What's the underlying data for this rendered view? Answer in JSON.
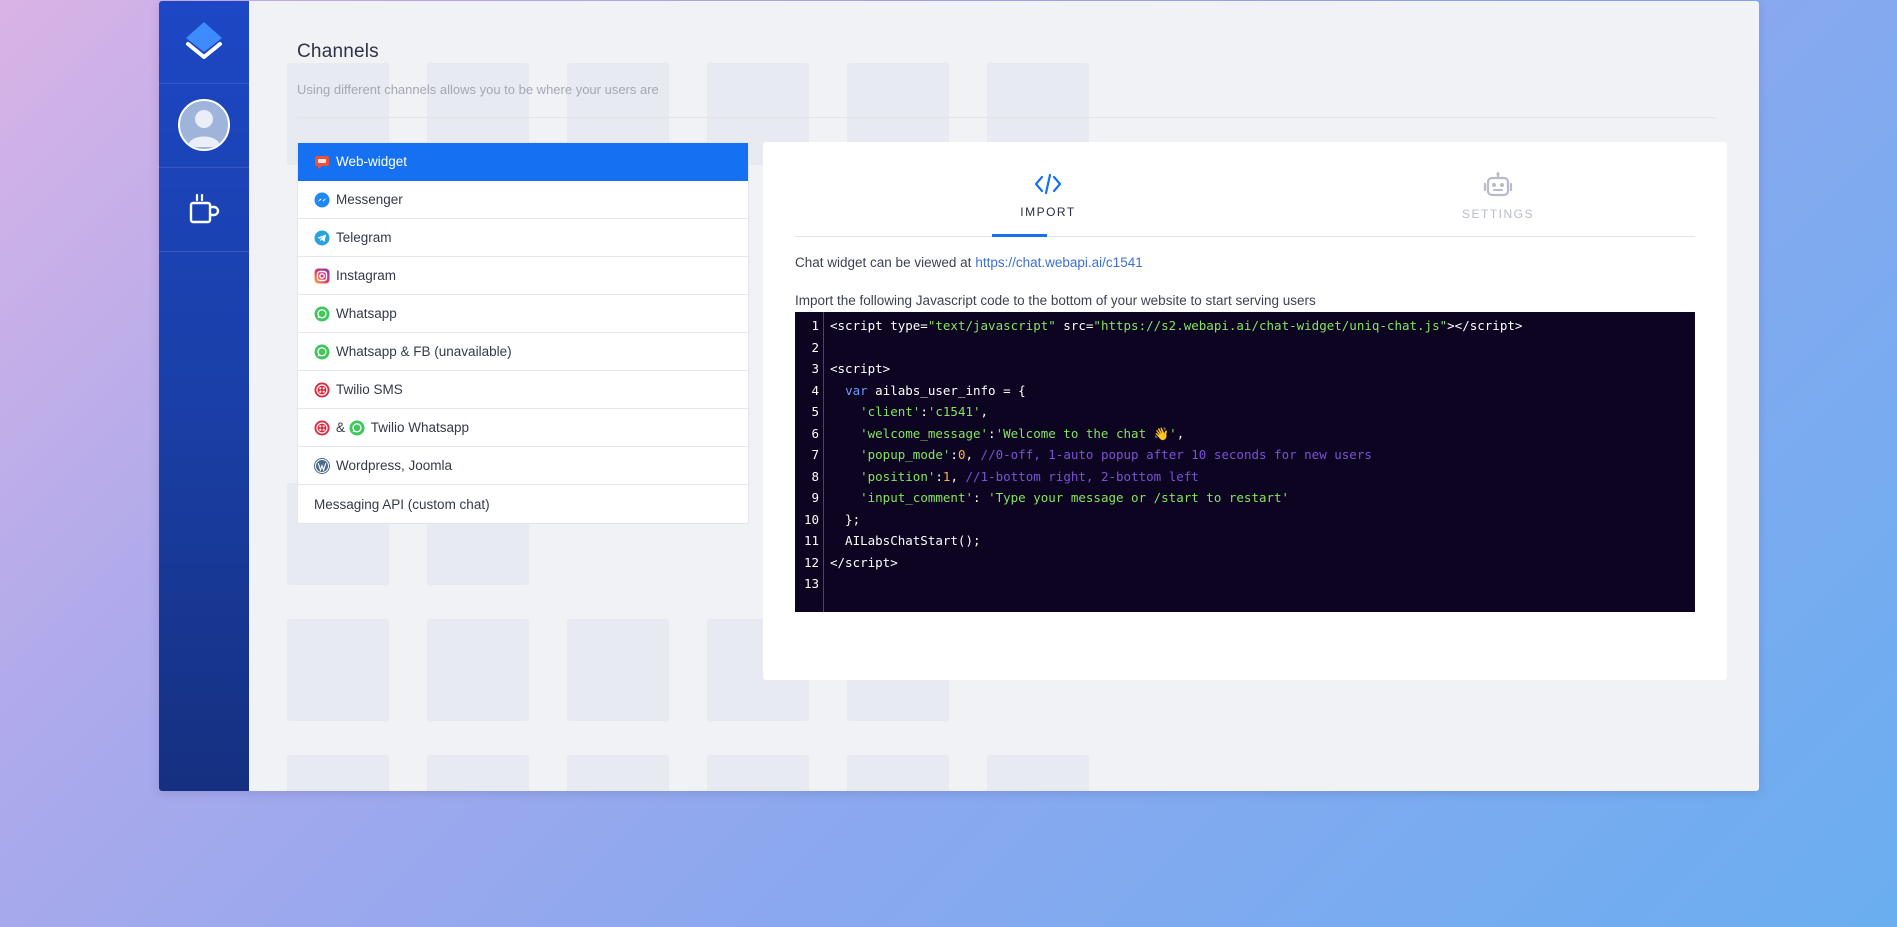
{
  "page": {
    "title": "Channels",
    "subtitle": "Using different channels allows you to be where your users are"
  },
  "sidebar": {
    "icons": [
      "logo-icon",
      "user-avatar-icon",
      "coffee-cup-icon"
    ]
  },
  "channels": [
    {
      "label": "Web-widget",
      "icon": "web-widget-icon",
      "active": true
    },
    {
      "label": "Messenger",
      "icon": "messenger-icon",
      "active": false
    },
    {
      "label": "Telegram",
      "icon": "telegram-icon",
      "active": false
    },
    {
      "label": "Instagram",
      "icon": "instagram-icon",
      "active": false
    },
    {
      "label": "Whatsapp",
      "icon": "whatsapp-icon",
      "active": false
    },
    {
      "label": "Whatsapp & FB (unavailable)",
      "icon": "whatsapp-icon",
      "active": false
    },
    {
      "label": "Twilio SMS",
      "icon": "twilio-icon",
      "active": false
    },
    {
      "label": "& ",
      "label2": "Twilio Whatsapp",
      "icon": "twilio-icon",
      "icon2": "whatsapp-icon",
      "active": false
    },
    {
      "label": "Wordpress, Joomla",
      "icon": "wordpress-icon",
      "active": false
    },
    {
      "label": "Messaging API (custom chat)",
      "icon": "",
      "active": false
    }
  ],
  "tabs": [
    {
      "label": "IMPORT",
      "icon": "code-icon",
      "active": true
    },
    {
      "label": "SETTINGS",
      "icon": "robot-icon",
      "active": false
    }
  ],
  "import": {
    "view_text": "Chat widget can be viewed at",
    "view_link": "https://chat.webapi.ai/c1541",
    "instruction": "Import the following Javascript code to the bottom of your website to start serving users",
    "line_numbers": [
      "1",
      "2",
      "3",
      "4",
      "5",
      "6",
      "7",
      "8",
      "9",
      "10",
      "11",
      "12",
      "13"
    ]
  },
  "colors": {
    "accent": "#1670f2",
    "sidebar": "#1a3fa8",
    "code_bg": "#0c0420",
    "code_string": "#86e35c",
    "code_keyword": "#6f9cff",
    "code_number": "#ffb347",
    "code_comment": "#7a52d6"
  }
}
